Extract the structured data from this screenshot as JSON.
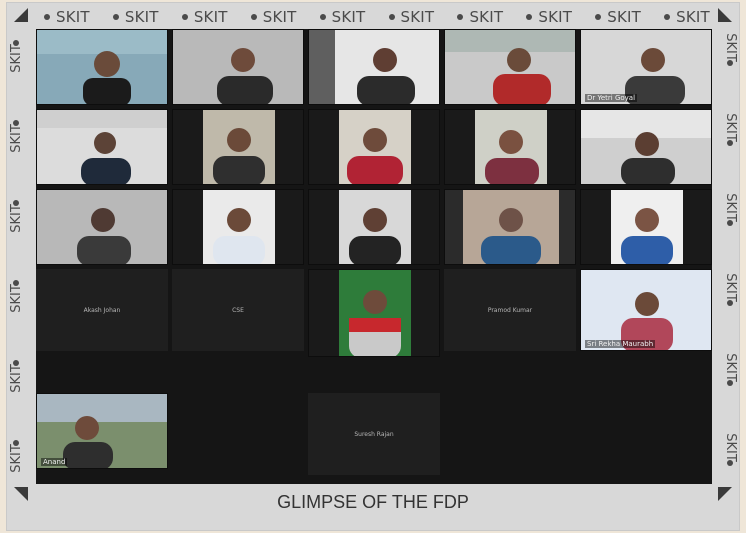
{
  "border_token": "SKIT",
  "caption": "GLIMPSE OF THE FDP",
  "tiles": {
    "r1c5": "Dr Yetri Goyal",
    "r4c1": "Akash Johan",
    "r4c2": "CSE",
    "r4c4": "Pramod Kumar",
    "r4c5": "Sri Rekha Maurabh",
    "r5c1": "Anand",
    "r5c3": "Suresh Rajan"
  },
  "colors": {
    "grid_bg": "#151515",
    "name_tile_bg": "#1f1f1f",
    "frame_bg": "#d8d8d8"
  }
}
